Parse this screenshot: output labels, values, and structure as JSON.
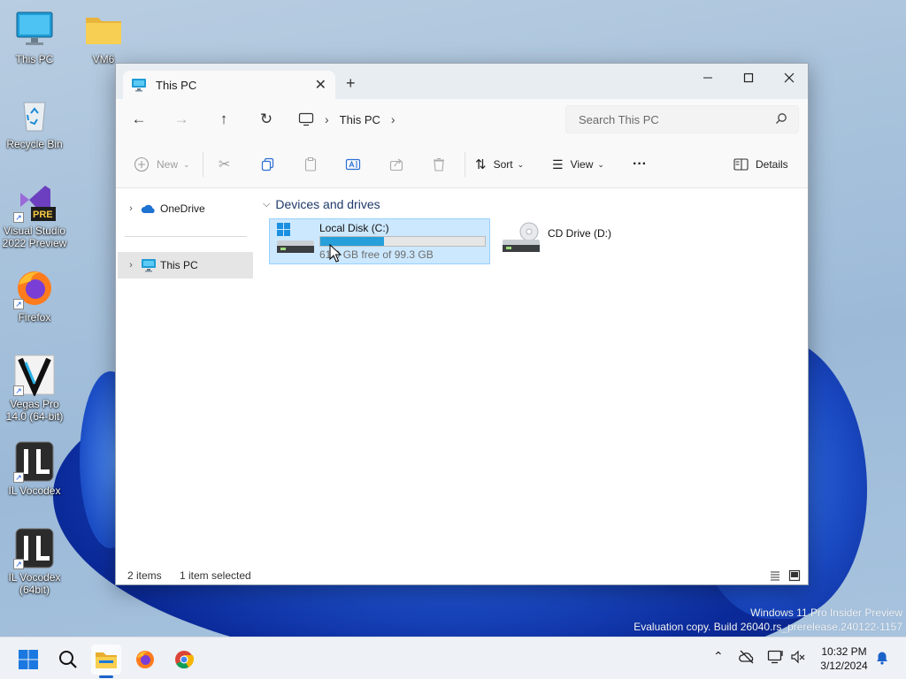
{
  "desktop": {
    "icons": [
      {
        "label": "This PC"
      },
      {
        "label": "VM6"
      },
      {
        "label": "Recycle Bin"
      },
      {
        "label": "Visual Studio 2022 Preview"
      },
      {
        "label": "Firefox"
      },
      {
        "label": "Vegas Pro 14.0 (64-bit)"
      },
      {
        "label": "IL Vocodex"
      },
      {
        "label": "IL Vocodex (64bit)"
      }
    ],
    "vs_badge": "PRE",
    "watermark_line1": "Windows 11 Pro Insider Preview",
    "watermark_line2": "Evaluation copy. Build 26040.rs_prerelease.240122-1157"
  },
  "window": {
    "tab_title": "This PC",
    "new_tab_glyph": "+",
    "search_placeholder": "Search This PC",
    "breadcrumb": {
      "current": "This PC"
    },
    "toolbar": {
      "new_label": "New",
      "sort_label": "Sort",
      "view_label": "View",
      "more_label": "···",
      "details_label": "Details"
    },
    "sidebar": {
      "items": [
        {
          "label": "OneDrive"
        },
        {
          "label": "This PC"
        }
      ]
    },
    "section_title": "Devices and drives",
    "drives": [
      {
        "name": "Local Disk (C:)",
        "free_text": "61.0 GB free of 99.3 GB",
        "used_fraction": 0.386
      },
      {
        "name": "CD Drive (D:)"
      }
    ],
    "status": {
      "item_count": "2 items",
      "selection": "1 item selected"
    }
  },
  "taskbar": {
    "clock_time": "10:32 PM",
    "clock_date": "3/12/2024"
  },
  "colors": {
    "accent": "#26a0da",
    "selection": "#cce8ff",
    "taskbar_accent": "#1b62c9"
  }
}
